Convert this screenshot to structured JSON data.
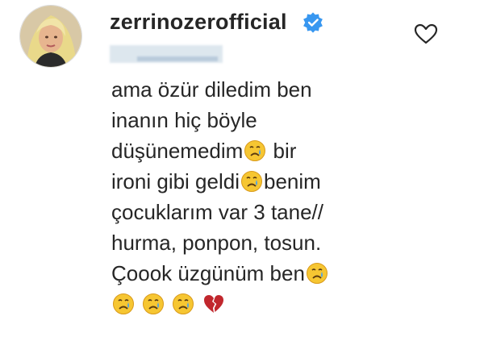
{
  "post": {
    "username": "zerrinozerofficial",
    "verified": true,
    "icons": {
      "avatar": "profile-photo",
      "verified": "verified-badge-icon",
      "like": "heart-outline-icon"
    },
    "comment_lines": [
      {
        "text": "ama özür diledim ben",
        "emoji_after": 0
      },
      {
        "text": "inanın hiç böyle",
        "emoji_after": 0
      },
      {
        "text": "düşünemedim",
        "emoji_after": 1,
        "tail": " bir"
      },
      {
        "text": "ironi gibi geldi",
        "emoji_after": 1,
        "tail": "benim"
      },
      {
        "text": "çocuklarım var 3 tane//",
        "emoji_after": 0
      },
      {
        "text": "hurma, ponpon, tosun.",
        "emoji_after": 0
      },
      {
        "text": "Çoook üzgünüm ben",
        "emoji_after": 1
      }
    ],
    "emoji_row": [
      "crying-face-emoji",
      "crying-face-emoji",
      "crying-face-emoji",
      "broken-heart-emoji"
    ],
    "colors": {
      "verified_blue": "#3897f0",
      "text": "#262626",
      "heart_red": "#c1272d",
      "emoji_yellow": "#f6c632"
    }
  }
}
